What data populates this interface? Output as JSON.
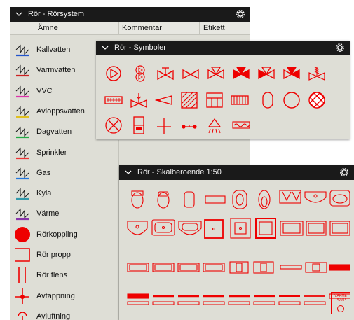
{
  "panels": {
    "rorsystem": {
      "title": "Rör - Rörsystem",
      "columns": [
        "Ämne",
        "Kommentar",
        "Etikett"
      ],
      "rows": [
        {
          "label": "Kallvatten",
          "icon": "pipe-squiggle-icon",
          "color": "#2255cc"
        },
        {
          "label": "Varmvatten",
          "icon": "pipe-squiggle-icon",
          "color": "#cc2222"
        },
        {
          "label": "VVC",
          "icon": "pipe-squiggle-icon",
          "color": "#dd33aa"
        },
        {
          "label": "Avloppsvatten",
          "icon": "pipe-squiggle-icon",
          "color": "#e0c020"
        },
        {
          "label": "Dagvatten",
          "icon": "pipe-squiggle-icon",
          "color": "#22aa44"
        },
        {
          "label": "Sprinkler",
          "icon": "pipe-squiggle-icon",
          "color": "#ee3333"
        },
        {
          "label": "Gas",
          "icon": "pipe-squiggle-icon",
          "color": "#2277dd"
        },
        {
          "label": "Kyla",
          "icon": "pipe-squiggle-icon",
          "color": "#3399aa"
        },
        {
          "label": "Värme",
          "icon": "pipe-squiggle-icon",
          "color": "#8833aa"
        },
        {
          "label": "Rörkoppling",
          "icon": "red-dot-icon",
          "color": "#ee0000"
        },
        {
          "label": "Rör propp",
          "icon": "pipe-plug-icon",
          "color": "#ee0000"
        },
        {
          "label": "Rör flens",
          "icon": "pipe-flange-icon",
          "color": "#ee0000"
        },
        {
          "label": "Avtappning",
          "icon": "drain-valve-icon",
          "color": "#ee0000"
        },
        {
          "label": "Avluftning",
          "icon": "air-vent-icon",
          "color": "#ee0000"
        }
      ]
    },
    "symboler": {
      "title": "Rör - Symboler"
    },
    "skalberoende": {
      "title": "Rör - Skalberoende 1:50",
      "pump_label_line1": "VÄRME",
      "pump_label_line2": "PUMP"
    }
  },
  "colors": {
    "accent": "#ee0000",
    "titlebar": "#1a1a1a",
    "panel": "#deded6"
  }
}
